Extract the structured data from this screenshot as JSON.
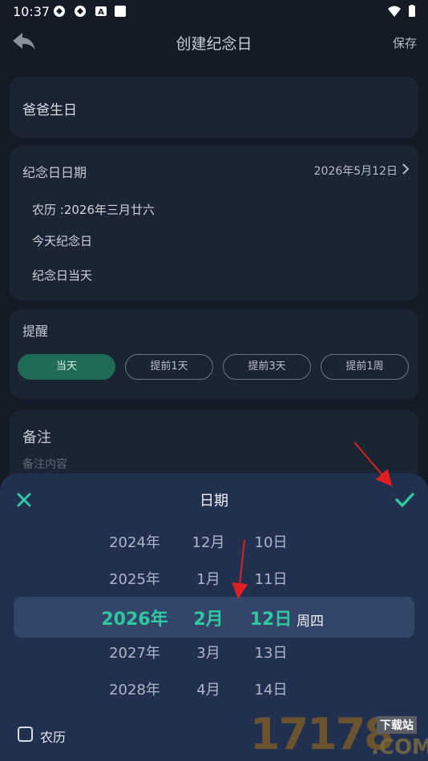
{
  "status_bar": {
    "time": "10:37"
  },
  "header": {
    "title": "创建纪念日",
    "save_label": "保存"
  },
  "name_card": {
    "value": "爸爸生日"
  },
  "date_card": {
    "label": "纪念日日期",
    "value": "2026年5月12日",
    "rows": [
      "农历 :2026年三月廿六",
      "今天纪念日",
      "纪念日当天"
    ]
  },
  "reminder": {
    "label": "提醒",
    "options": [
      "当天",
      "提前1天",
      "提前3天",
      "提前1周"
    ],
    "selected": "当天"
  },
  "note": {
    "label": "备注",
    "placeholder": "备注内容"
  },
  "picker": {
    "title": "日期",
    "years": [
      "2024年",
      "2025年",
      "2026年",
      "2027年",
      "2028年"
    ],
    "months": [
      "12月",
      "1月",
      "2月",
      "3月",
      "4月"
    ],
    "days": [
      "10日",
      "11日",
      "12日",
      "13日",
      "14日"
    ],
    "weekday": "周四",
    "lunar_label": "农历",
    "lunar_checked": false
  },
  "watermark": {
    "number": "17178",
    "site": "下载站",
    "domain": ".COM"
  },
  "colors": {
    "accent": "#2fc8a1",
    "sheet_bg": "#223050",
    "annotation_arrow": "#e02020"
  }
}
